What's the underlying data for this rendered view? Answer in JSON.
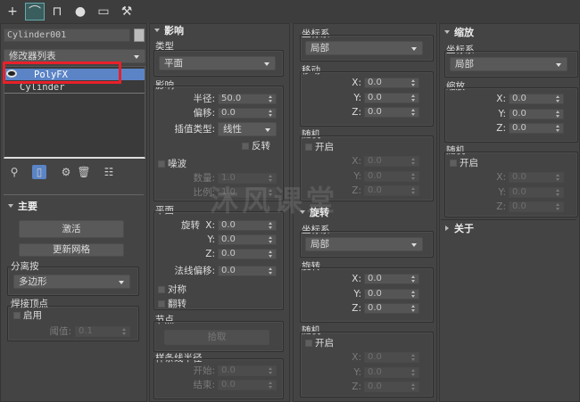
{
  "toolbar": {
    "icons": [
      "create-icon",
      "modify-icon",
      "hierarchy-icon",
      "motion-icon",
      "display-icon",
      "utilities-icon"
    ],
    "glyphs": [
      "+",
      "⌒",
      "⊓",
      "●",
      "▭",
      "⚒"
    ]
  },
  "object_name": "Cylinder001",
  "modifier_list": "修改器列表",
  "stack": [
    "PolyFX",
    "Cylinder"
  ],
  "stack_icons": [
    "pin-stack-icon",
    "show-end-result-icon",
    "make-unique-icon",
    "remove-modifier-icon",
    "configure-modifier-sets-icon"
  ],
  "main": {
    "title": "主要",
    "activate": "激活",
    "update_mesh": "更新网格",
    "separate_label": "分离按",
    "separate_value": "多边形",
    "weld_label": "焊接顶点",
    "enable": "启用",
    "threshold_label": "阈值:",
    "threshold": "0.1"
  },
  "influence": {
    "title": "影响",
    "type_label": "类型",
    "type_value": "平面",
    "group_label": "影响",
    "radius_label": "半径:",
    "radius": "50.0",
    "offset_label": "偏移:",
    "offset": "0.0",
    "interp_label": "插值类型:",
    "interp_value": "线性",
    "invert": "反转",
    "noise": "噪波",
    "amount_label": "数量:",
    "amount": "1.0",
    "scale_label": "比例:",
    "scale": "1.0",
    "plane_label": "平面",
    "rotate_label": "旋转",
    "x": "X:",
    "y": "Y:",
    "z": "Z:",
    "rx": "0.0",
    "ry": "0.0",
    "rz": "0.0",
    "normal_offset_label": "法线偏移:",
    "normal_offset": "0.0",
    "symmetry": "对称",
    "flip": "翻转",
    "node_label": "节点",
    "pick": "拾取",
    "spline_label": "样条线半径",
    "start_label": "开始:",
    "start": "0.0",
    "end_label": "结束:",
    "end": "0.0"
  },
  "move": {
    "coord_label": "坐标系",
    "coord_value": "局部",
    "group_label": "移动",
    "x": "X:",
    "y": "Y:",
    "z": "Z:",
    "vx": "0.0",
    "vy": "0.0",
    "vz": "0.0",
    "random_label": "随机",
    "enable": "开启",
    "rvx": "0.0",
    "rvy": "0.0",
    "rvz": "0.0"
  },
  "rotate": {
    "title": "旋转",
    "coord_label": "坐标系",
    "coord_value": "局部",
    "group_label": "旋转",
    "x": "X:",
    "y": "Y:",
    "z": "Z:",
    "vx": "0.0",
    "vy": "0.0",
    "vz": "0.0",
    "random_label": "随机",
    "enable": "开启",
    "rvx": "0.0",
    "rvy": "0.0",
    "rvz": "0.0"
  },
  "scale": {
    "title": "缩放",
    "coord_label": "坐标系",
    "coord_value": "局部",
    "group_label": "缩放",
    "x": "X:",
    "y": "Y:",
    "z": "Z:",
    "vx": "0.0",
    "vy": "0.0",
    "vz": "0.0",
    "random_label": "随机",
    "enable": "开启",
    "rvx": "0.0",
    "rvy": "0.0",
    "rvz": "0.0"
  },
  "about": {
    "title": "关于"
  },
  "watermark": "沐风课堂",
  "colors": {
    "selection": "#5b84c6",
    "highlight_box": "#e8202a"
  }
}
